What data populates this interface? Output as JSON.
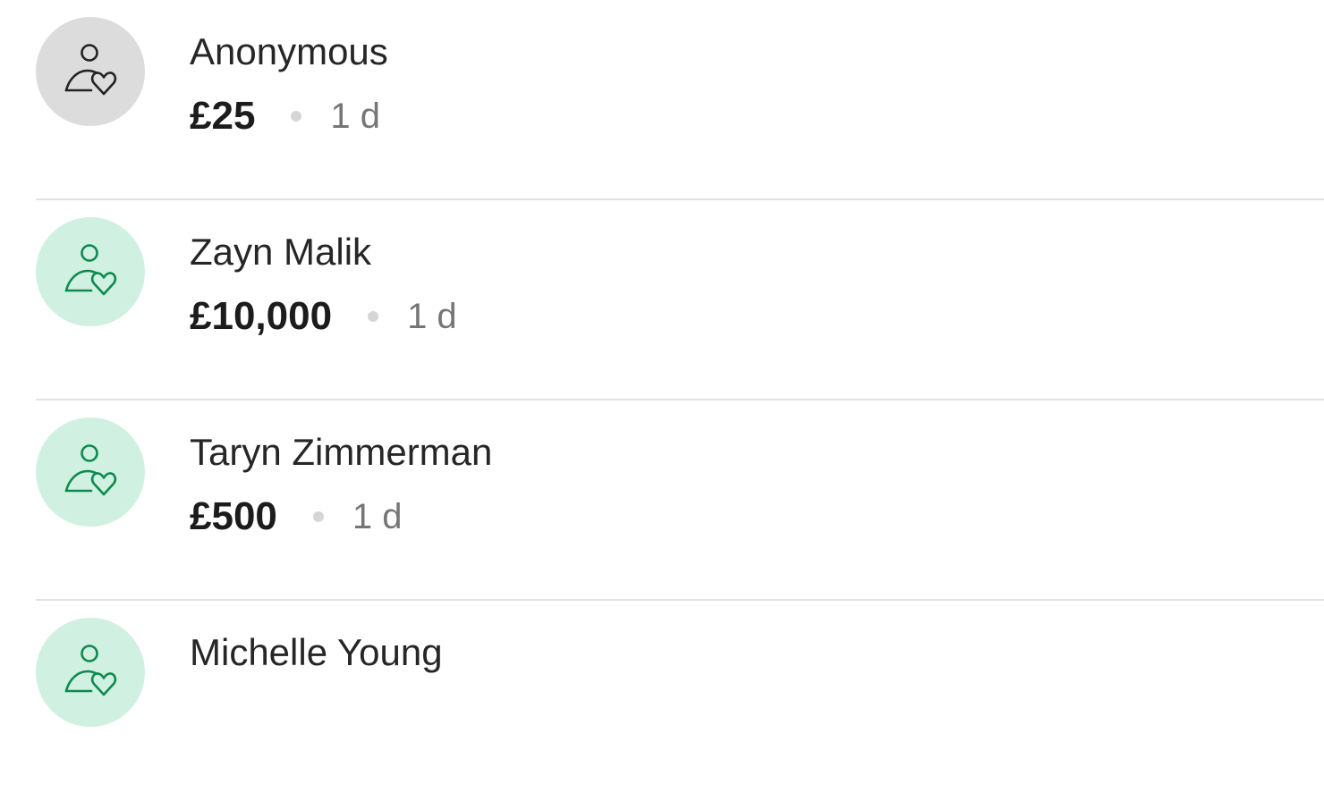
{
  "donations": [
    {
      "name": "Anonymous",
      "amount": "£25",
      "time": "1 d",
      "avatar_icon": "person-heart-icon",
      "avatar_style": "anonymous"
    },
    {
      "name": "Zayn Malik",
      "amount": "£10,000",
      "time": "1 d",
      "avatar_icon": "person-heart-icon",
      "avatar_style": "named"
    },
    {
      "name": "Taryn Zimmerman",
      "amount": "£500",
      "time": "1 d",
      "avatar_icon": "person-heart-icon",
      "avatar_style": "named"
    },
    {
      "name": "Michelle Young",
      "amount": "",
      "time": "",
      "avatar_icon": "person-heart-icon",
      "avatar_style": "named"
    }
  ],
  "colors": {
    "anonymous_avatar_bg": "#dcdcdc",
    "anonymous_icon": "#222222",
    "named_avatar_bg": "#d0f0e1",
    "named_icon": "#0d8a4e",
    "divider": "#e2e2e2",
    "muted_text": "#767676"
  }
}
